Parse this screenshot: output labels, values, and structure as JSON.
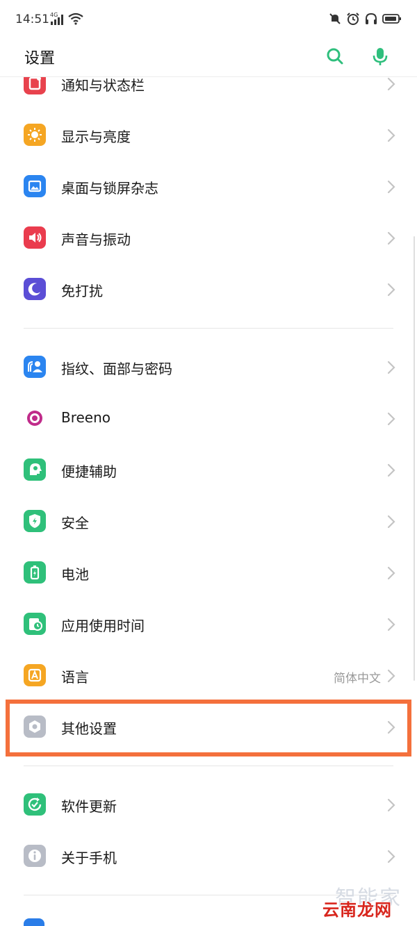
{
  "status": {
    "time": "14:51",
    "network": "4G"
  },
  "header": {
    "title": "设置"
  },
  "items": [
    {
      "label": "通知与状态栏",
      "color": "#e8424d",
      "icon": "notification-icon"
    },
    {
      "label": "显示与亮度",
      "color": "#f5a623",
      "icon": "brightness-icon"
    },
    {
      "label": "桌面与锁屏杂志",
      "color": "#2b85f0",
      "icon": "wallpaper-icon"
    },
    {
      "label": "声音与振动",
      "color": "#ea3c4e",
      "icon": "speaker-icon"
    },
    {
      "label": "免打扰",
      "color": "#5b4ed6",
      "icon": "moon-icon"
    },
    {
      "label": "指纹、面部与密码",
      "color": "#2b85f0",
      "icon": "fingerprint-face-icon"
    },
    {
      "label": "Breeno",
      "color": "#c02b8a",
      "icon": "breeno-icon"
    },
    {
      "label": "便捷辅助",
      "color": "#2fc07a",
      "icon": "assist-icon"
    },
    {
      "label": "安全",
      "color": "#2fc07a",
      "icon": "shield-icon"
    },
    {
      "label": "电池",
      "color": "#2fc07a",
      "icon": "battery-icon"
    },
    {
      "label": "应用使用时间",
      "color": "#2fc07a",
      "icon": "app-usage-icon"
    },
    {
      "label": "语言",
      "value": "简体中文",
      "color": "#f5a623",
      "icon": "language-icon"
    },
    {
      "label": "其他设置",
      "color": "#b8bcc6",
      "icon": "other-settings-icon"
    },
    {
      "label": "软件更新",
      "color": "#2fc07a",
      "icon": "update-icon"
    },
    {
      "label": "关于手机",
      "color": "#b8bcc6",
      "icon": "info-icon"
    }
  ],
  "watermark": {
    "line1": "智能家",
    "line2": "云南龙网"
  }
}
